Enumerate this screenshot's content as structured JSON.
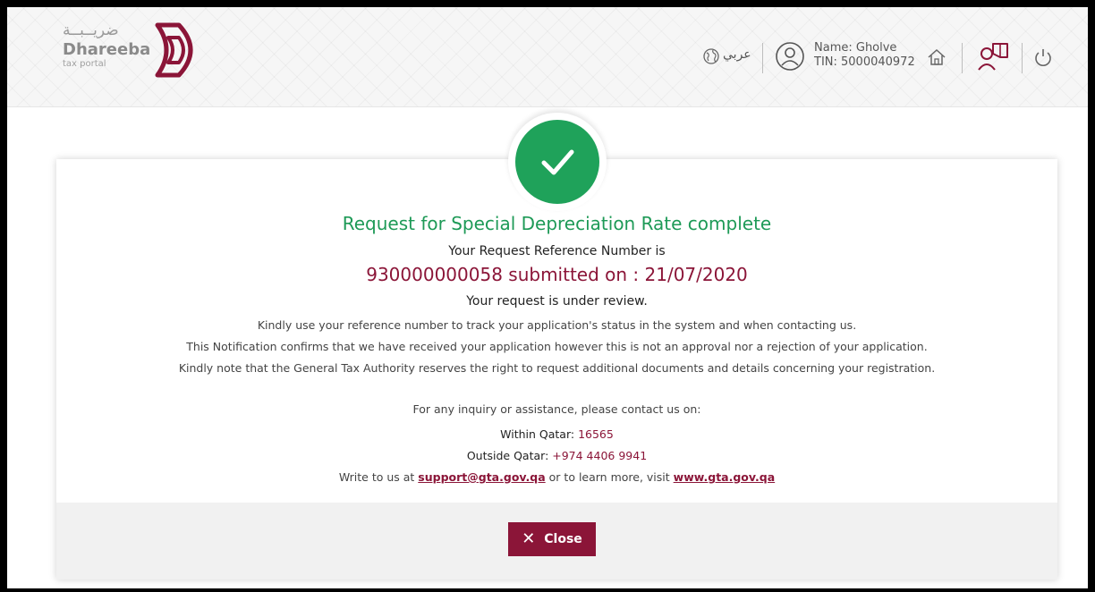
{
  "header": {
    "logo_arabic": "ضريــبــة",
    "logo_name": "Dhareeba",
    "logo_sub": "tax portal",
    "language_label": "عربي",
    "user_name": "Name: Gholve",
    "user_tin": "TIN: 5000040972",
    "icons": [
      "globe-icon",
      "user-icon",
      "home-icon",
      "user-guide-icon",
      "power-icon"
    ]
  },
  "confirmation": {
    "title": "Request for Special Depreciation Rate complete",
    "reference_label": "Your Request Reference Number is",
    "reference_line": "930000000058 submitted on : 21/07/2020",
    "review_status": "Your request is under review.",
    "paragraph_1": "Kindly use your reference number to track your application's status in the system and when contacting us.",
    "paragraph_2": "This Notification confirms that we have received your application however this is not an approval nor a rejection of your application.",
    "paragraph_3": "Kindly note that the General Tax Authority reserves the right to request additional documents and details concerning your registration.",
    "inquiry": "For any inquiry or assistance, please contact us on:",
    "within_label": "Within Qatar",
    "within_number": "16565",
    "outside_label": "Outside Qatar",
    "outside_number": "+974 4406 9941",
    "write_prefix": "Write to us at",
    "email": "support@gta.gov.qa",
    "write_middle": "or to learn more, visit",
    "website": "www.gta.gov.qa"
  },
  "footer": {
    "close_label": "Close"
  },
  "colors": {
    "brand": "#8b1538",
    "success": "#1fa25a"
  }
}
